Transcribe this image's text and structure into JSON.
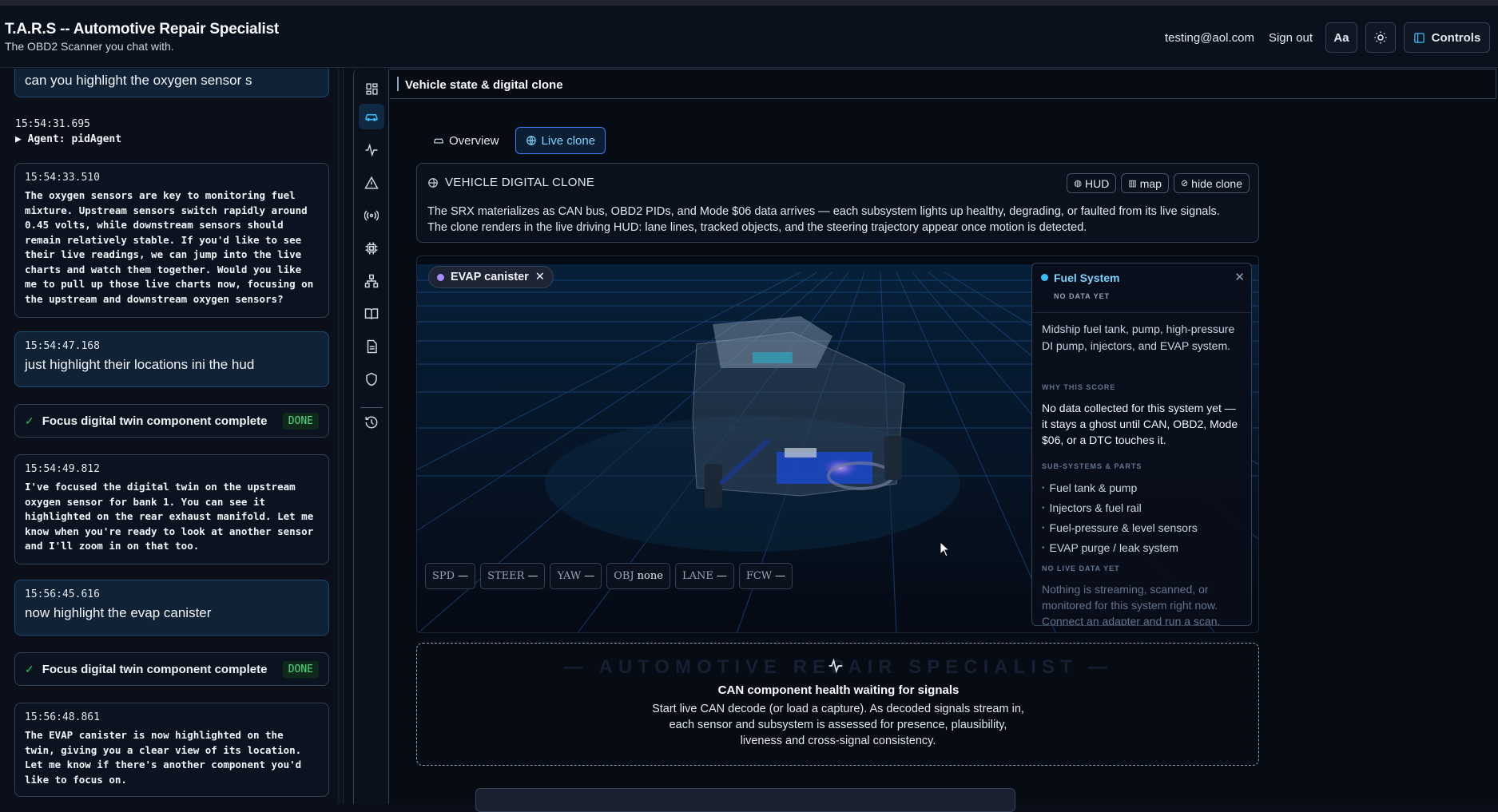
{
  "header": {
    "title": "T.A.R.S -- Automotive Repair Specialist",
    "subtitle": "The OBD2 Scanner you chat with.",
    "email": "testing@aol.com",
    "signout": "Sign out",
    "font_btn": "Aa",
    "controls": "Controls"
  },
  "chat": {
    "msg1_text": "can you highlight the oxygen sensor s",
    "ts2": "15:54:31.695",
    "agent_line": "▶ Agent: pidAgent",
    "msg3_ts": "15:54:33.510",
    "msg3_text": "The oxygen sensors are key to monitoring fuel mixture. Upstream sensors switch rapidly around 0.45 volts, while downstream sensors should remain relatively stable. If you'd like to see their live readings, we can jump into the live charts and watch them together. Would you like me to pull up those live charts now, focusing on the upstream and downstream oxygen sensors?",
    "msg4_ts": "15:54:47.168",
    "msg4_text": "just highlight their locations ini the hud",
    "task1_label": "Focus digital twin component complete",
    "task1_status": "DONE",
    "msg5_ts": "15:54:49.812",
    "msg5_text": "I've focused the digital twin on the upstream oxygen sensor for bank 1. You can see it highlighted on the rear exhaust manifold. Let me know when you're ready to look at another sensor and I'll zoom in on that too.",
    "msg6_ts": "15:56:45.616",
    "msg6_text": "now highlight the evap canister",
    "task2_label": "Focus digital twin component complete",
    "task2_status": "DONE",
    "msg7_ts": "15:56:48.861",
    "msg7_text": "The EVAP canister is now highlighted on the twin, giving you a clear view of its location. Let me know if there's another component you'd like to focus on."
  },
  "main": {
    "section_title": "Vehicle state & digital clone",
    "tab_overview": "Overview",
    "tab_live": "Live clone",
    "clone_title": "VEHICLE DIGITAL CLONE",
    "btn_hud": "HUD",
    "btn_map": "map",
    "btn_hide": "hide clone",
    "clone_desc": "The SRX materializes as CAN bus, OBD2 PIDs, and Mode $06 data arrives — each subsystem lights up healthy, degrading, or faulted from its live signals. The clone renders in the live driving HUD: lane lines, tracked objects, and the steering trajectory appear once motion is detected.",
    "chip": "EVAP canister",
    "hud": [
      {
        "k": "SPD",
        "v": "—"
      },
      {
        "k": "STEER",
        "v": "—"
      },
      {
        "k": "YAW",
        "v": "—"
      },
      {
        "k": "OBJ",
        "v": "none"
      },
      {
        "k": "LANE",
        "v": "—"
      },
      {
        "k": "FCW",
        "v": "—"
      }
    ]
  },
  "panel": {
    "name": "Fuel System",
    "status": "NO DATA YET",
    "desc": "Midship fuel tank, pump, high-pressure DI pump, injectors, and EVAP system.",
    "why_label": "WHY THIS SCORE",
    "why": "No data collected for this system yet — it stays a ghost until CAN, OBD2, Mode $06, or a DTC touches it.",
    "parts_label": "SUB-SYSTEMS & PARTS",
    "parts": [
      "Fuel tank & pump",
      "Injectors & fuel rail",
      "Fuel-pressure & level sensors",
      "EVAP purge / leak system"
    ],
    "nolive_label": "NO LIVE DATA YET",
    "nolive": "Nothing is streaming, scanned, or monitored for this system right now. Connect an adapter and run a scan."
  },
  "health": {
    "watermark": "— AUTOMOTIVE REPAIR SPECIALIST —",
    "title": "CAN component health waiting for signals",
    "desc": "Start live CAN decode (or load a capture). As decoded signals stream in, each sensor and subsystem is assessed for presence, plausibility, liveness and cross-signal consistency."
  },
  "colors": {
    "accent": "#38bdf8",
    "done": "#4ade80",
    "evap": "#a78bfa"
  }
}
